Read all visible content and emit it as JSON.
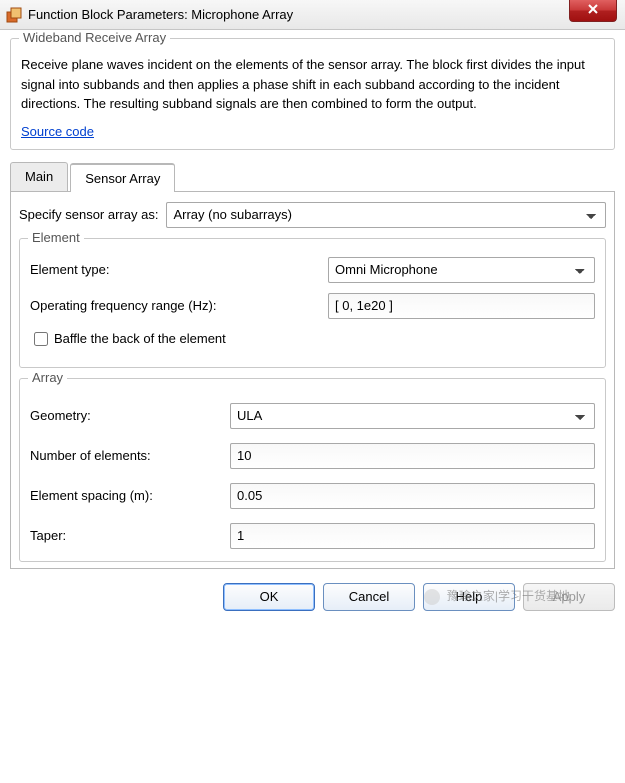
{
  "window": {
    "title": "Function Block Parameters: Microphone Array"
  },
  "description": {
    "heading": "Wideband Receive Array",
    "body": "Receive plane waves incident on the elements of the sensor array. The block first divides the input signal into subbands and then applies a phase shift in each subband according to the incident directions. The resulting subband signals are then combined to form the output.",
    "link": "Source code"
  },
  "tabs": {
    "main": "Main",
    "sensor_array": "Sensor Array",
    "active": 1
  },
  "form": {
    "specify_label": "Specify sensor array as:",
    "specify_value": "Array (no subarrays)",
    "element": {
      "legend": "Element",
      "type_label": "Element type:",
      "type_value": "Omni Microphone",
      "freq_label": "Operating frequency range (Hz):",
      "freq_value": "[ 0, 1e20 ]",
      "baffle_label": "Baffle the back of the element",
      "baffle_checked": false
    },
    "array": {
      "legend": "Array",
      "geometry_label": "Geometry:",
      "geometry_value": "ULA",
      "num_label": "Number of elements:",
      "num_value": "10",
      "spacing_label": "Element spacing (m):",
      "spacing_value": "0.05",
      "taper_label": "Taper:",
      "taper_value": "1"
    }
  },
  "buttons": {
    "ok": "OK",
    "cancel": "Cancel",
    "help": "Help",
    "apply": "Apply"
  },
  "watermark": "豫瑜之家|学习干货基地"
}
